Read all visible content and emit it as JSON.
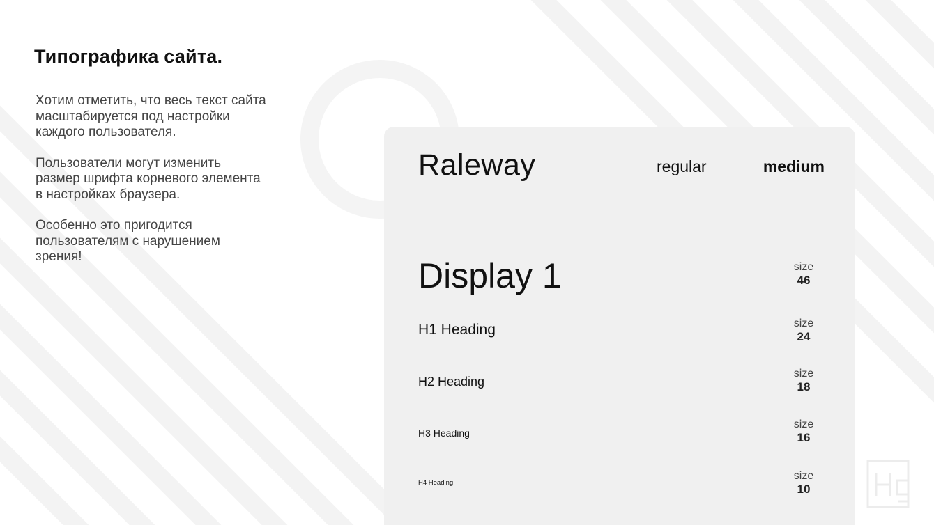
{
  "slide": {
    "title": "Типографика сайта.",
    "paragraphs": [
      "Хотим отметить, что весь текст сайта\nмасштабируется под настройки\nкаждого пользователя.",
      "Пользователи могут изменить\nразмер шрифта корневого элемента\nв настройках браузера.",
      "Особенно это пригодится\nпользователям с нарушением\nзрения!"
    ]
  },
  "card": {
    "font_name": "Raleway",
    "weights": {
      "regular": "regular",
      "medium": "medium"
    },
    "size_label": "size",
    "styles": [
      {
        "name": "Display 1",
        "size": "46"
      },
      {
        "name": "H1 Heading",
        "size": "24"
      },
      {
        "name": "H2 Heading",
        "size": "18"
      },
      {
        "name": "H3 Heading",
        "size": "16"
      },
      {
        "name": "H4 Heading",
        "size": "10"
      }
    ]
  },
  "colors": {
    "background": "#ffffff",
    "stripes": "#f2f2f2",
    "card": "#f0f0f0",
    "text": "#111111",
    "muted_text": "#444444"
  },
  "icons": {
    "watermark": "hg-logo-icon"
  }
}
